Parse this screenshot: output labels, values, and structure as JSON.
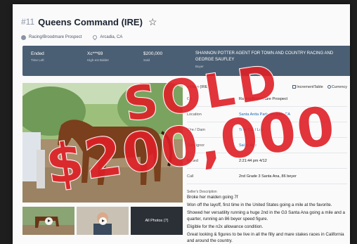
{
  "header": {
    "lot": "#11",
    "title": "Queens Command (IRE)",
    "category": "Racing/Broodmare Prospect",
    "location": "Arcadia, CA"
  },
  "status": {
    "ended_value": "Ended",
    "ended_label": "Time Left",
    "bidder_value": "Xc***69",
    "bidder_label": "High-est Bidder",
    "price_value": "$200,000",
    "price_label": "Sold",
    "buyer_value": "SHANNON POTTER AGENT FOR TOWN AND COUNTRY RACING AND GEORGE SAUFLEY",
    "buyer_label": "Buyer"
  },
  "toolbar": {
    "lead": "y Mare (IRE)",
    "increment": "IncrementTable",
    "currency": "Currency"
  },
  "details": [
    {
      "key": "Ca",
      "value": "Racing/Broodmare Prospect",
      "link": false
    },
    {
      "key": "Location",
      "value": "Santa Anita Park, Arcadia, CA",
      "link": true
    },
    {
      "key": "Sire / Dam",
      "value": "True Cat / Lov",
      "link": true
    },
    {
      "key": "Consignor",
      "value": "Sales Age",
      "link": true
    },
    {
      "key": "Ended",
      "value": "2:21:44 pm 4/12",
      "link": false
    },
    {
      "key": "Call",
      "value": "2nd Grade 3 Santa Ana, 86 beyer",
      "link": false
    }
  ],
  "description": {
    "label": "Seller's Description",
    "lines": [
      "Broke her maiden going 7f",
      "Won off the layoff, first time in the United States going a mile at the favorite.",
      "Showed her versatility running a huge 2nd in the G3 Santa Ana going a mile and a quarter, running an 86 beyer speed figure.",
      "Eligible for the n2x allowance condition.",
      "Great looking & figures to be live in all the filly and mare stakes races in California and around the country."
    ]
  },
  "thumbs": {
    "all_photos": "All Photos (7)"
  },
  "stamp": {
    "sold": "SOLD",
    "price": "$200,000"
  },
  "colors": {
    "status_bar": "#4b5f74",
    "stamp_red": "#de1f26",
    "link": "#1e6bb8"
  }
}
